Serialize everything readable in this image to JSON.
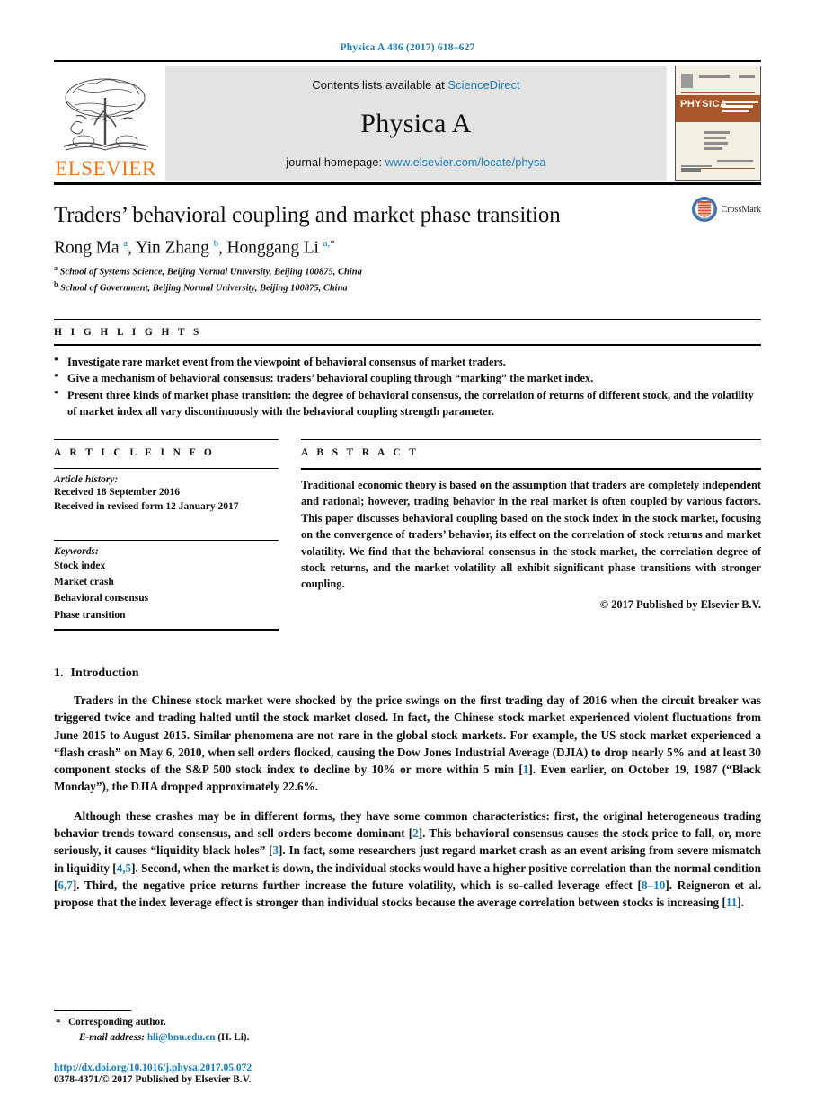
{
  "running_head": "Physica A 486 (2017) 618–627",
  "masthead": {
    "publisher_name": "ELSEVIER",
    "contents_prefix": "Contents lists available at",
    "contents_link": "ScienceDirect",
    "journal_name": "Physica A",
    "homepage_prefix": "journal homepage:",
    "homepage_link": "www.elsevier.com/locate/physa",
    "cover_label": "PHYSICA"
  },
  "title_block": {
    "title": "Traders’ behavioral coupling and market phase transition",
    "authors_html": "Rong Ma <sup>a</sup>, Yin Zhang <sup>b</sup>, Honggang Li <sup>a,*</sup>",
    "authors_plain": "Rong Ma a, Yin Zhang b, Honggang Li a,*",
    "affiliations": [
      {
        "marker": "a",
        "text": "School of Systems Science, Beijing Normal University, Beijing 100875, China"
      },
      {
        "marker": "b",
        "text": "School of Government, Beijing Normal University, Beijing 100875, China"
      }
    ],
    "crossmark_label": "CrossMark"
  },
  "highlights": {
    "label": "H I G H L I G H T S",
    "items": [
      "Investigate rare market event from the viewpoint of behavioral consensus of market traders.",
      "Give a mechanism of behavioral consensus: traders’ behavioral coupling through “marking” the market index.",
      "Present three kinds of market phase transition: the degree of behavioral consensus, the correlation of returns of different stock, and the volatility of market index all vary discontinuously with the behavioral coupling strength parameter."
    ]
  },
  "article_info": {
    "label": "A R T I C L E    I N F O",
    "history_title": "Article history:",
    "history_lines": [
      "Received 18 September 2016",
      "Received in revised form 12 January 2017"
    ],
    "keywords_title": "Keywords:",
    "keywords": [
      "Stock index",
      "Market crash",
      "Behavioral consensus",
      "Phase transition"
    ]
  },
  "abstract": {
    "label": "A B S T R A C T",
    "text": "Traditional economic theory is based on the assumption that traders are completely independent and rational; however, trading behavior in the real market is often coupled by various factors. This paper discusses behavioral coupling based on the stock index in the stock market, focusing on the convergence of traders’ behavior, its effect on the correlation of stock returns and market volatility. We find that the behavioral consensus in the stock market, the correlation degree of stock returns, and the market volatility all exhibit significant phase transitions with stronger coupling.",
    "copyright": "© 2017 Published by Elsevier B.V."
  },
  "introduction": {
    "number": "1.",
    "heading": "Introduction",
    "paragraph_1_parts": [
      {
        "t": "Traders in the Chinese stock market were shocked by the price swings on the first trading day of 2016 when the circuit breaker was triggered twice and trading halted until the stock market closed. In fact, the Chinese stock market experienced violent fluctuations from June 2015 to August 2015. Similar phenomena are not rare in the global stock markets. For example, the US stock market experienced a “flash crash” on May 6, 2010, when sell orders flocked, causing the Dow Jones Industrial Average (DJIA) to drop nearly 5% and at least 30 component stocks of the S&P 500 stock index to decline by 10% or more within 5 min ["
      },
      {
        "c": "1"
      },
      {
        "t": "]. Even earlier, on October 19, 1987 (“Black Monday”), the DJIA dropped approximately 22.6%."
      }
    ],
    "paragraph_2_parts": [
      {
        "t": "Although these crashes may be in different forms, they have some common characteristics: first, the original heterogeneous trading behavior trends toward consensus, and sell orders become dominant ["
      },
      {
        "c": "2"
      },
      {
        "t": "]. This behavioral consensus causes the stock price to fall, or, more seriously, it causes “liquidity black holes” ["
      },
      {
        "c": "3"
      },
      {
        "t": "]. In fact, some researchers just regard market crash as an event arising from severe mismatch in liquidity ["
      },
      {
        "c": "4,5"
      },
      {
        "t": "]. Second, when the market is down, the individual stocks would have a higher positive correlation than the normal condition ["
      },
      {
        "c": "6,7"
      },
      {
        "t": "]. Third, the negative price returns further increase the future volatility, which is so-called leverage effect ["
      },
      {
        "c": "8–10"
      },
      {
        "t": "]. Reigneron et al. propose that the index leverage effect is stronger than individual stocks because the average correlation between stocks is increasing ["
      },
      {
        "c": "11"
      },
      {
        "t": "]."
      }
    ]
  },
  "footnotes": {
    "corresponding_marker": "*",
    "corresponding_text": "Corresponding author.",
    "email_label": "E-mail address:",
    "email": "hli@bnu.edu.cn",
    "email_suffix": "(H. Li)."
  },
  "doi": {
    "url": "http://dx.doi.org/10.1016/j.physa.2017.05.072",
    "issn_line": "0378-4371/© 2017 Published by Elsevier B.V."
  },
  "colors": {
    "link_blue": "#1a7db6",
    "elsevier_orange": "#e87722",
    "masthead_grey": "#e3e3e3",
    "cover_brown": "#a8572a"
  }
}
